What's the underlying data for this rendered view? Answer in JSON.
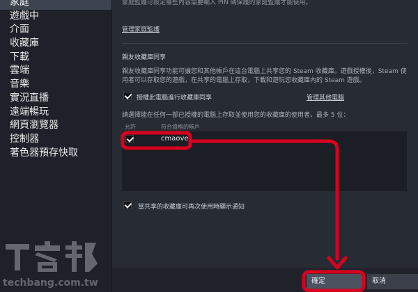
{
  "sidebar": {
    "items": [
      {
        "label": "家庭",
        "active": true
      },
      {
        "label": "遊戲中"
      },
      {
        "label": "介面"
      },
      {
        "label": "收藏庫"
      },
      {
        "label": "下載"
      },
      {
        "label": "雲端"
      },
      {
        "label": "音樂"
      },
      {
        "label": "實況直播"
      },
      {
        "label": "遠端暢玩"
      },
      {
        "label": "網頁瀏覽器"
      },
      {
        "label": "控制器"
      },
      {
        "label": "著色器預存快取"
      }
    ]
  },
  "family": {
    "top_text": "家庭監護可設定哪些內容需要輸入 PIN 碼保護的家庭監護才能使用。",
    "manage_family_view_link": "管理家庭監護"
  },
  "library_sharing": {
    "title": "親友收藏庫同享",
    "description": "親友收藏庫同享功能可讓您和其他帳戶在這台電腦上共享您的 Steam 收藏庫。遊戲授權後，Steam 使用者可以存取您的遊戲，在共享的電腦上存取，下載和遊玩您收藏庫內的 Steam 遊戲。",
    "authorize_label": "授權此電腦進行收藏庫同享",
    "authorize_checked": true,
    "manage_other_computers_link": "管理其他電腦",
    "select_prompt": "請選擇能在任何一部已授權的電腦上存取並使用您的收藏庫的使用者，最多 5 位：",
    "table": {
      "headers": [
        "允許",
        "符合資格的帳戶"
      ],
      "rows": [
        {
          "checked": true,
          "account": "cmaover"
        }
      ]
    },
    "notify_label": "當共享的收藏庫可再次使用時顯示通知",
    "notify_checked": true
  },
  "buttons": {
    "ok": "確定",
    "cancel": "取消"
  },
  "watermark": {
    "logo_text": "T客邦",
    "url_text": "techbang.com.tw"
  },
  "colors": {
    "annotation_red": "#d8001f",
    "sidebar_active": "#3d4450"
  }
}
